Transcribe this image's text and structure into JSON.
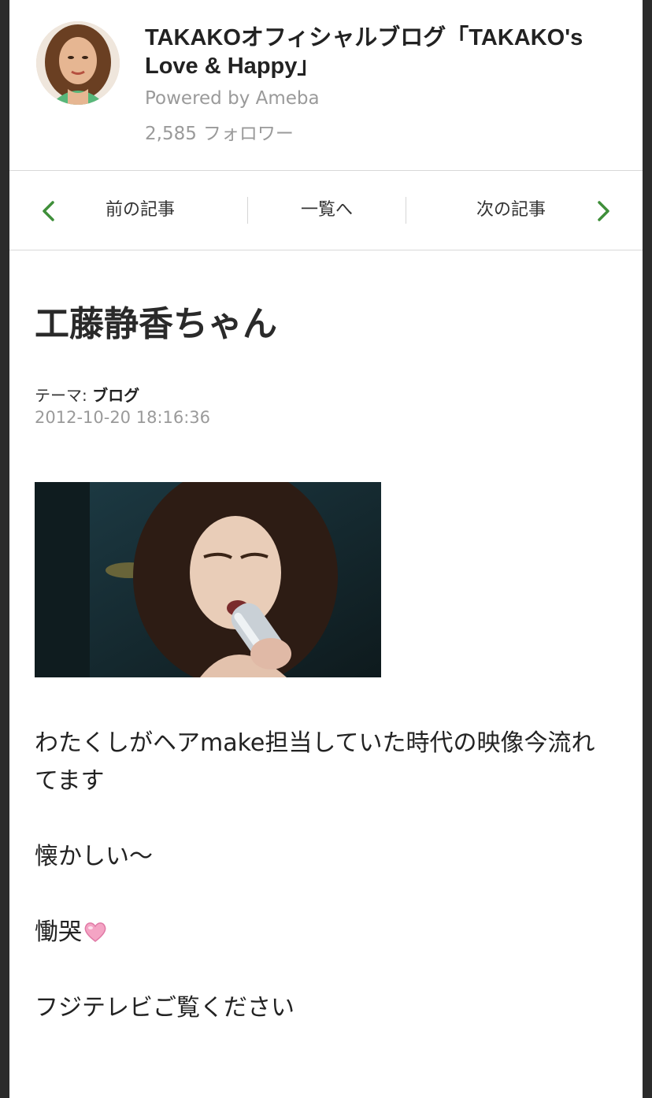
{
  "blog": {
    "title": "TAKAKOオフィシャルブログ「TAKAKO's Love & Happy」",
    "powered_by": "Powered by Ameba",
    "follower_count": "2,585",
    "follower_label": "フォロワー"
  },
  "nav": {
    "prev_label": "前の記事",
    "list_label": "一覧へ",
    "next_label": "次の記事",
    "accent_color": "#3f8f3a"
  },
  "post": {
    "title": "工藤静香ちゃん",
    "theme_label": "テーマ:",
    "theme_value": "ブログ",
    "date": "2012-10-20 18:16:36",
    "paragraphs": [
      "わたくしがヘアmake担当していた時代の映像今流れてます",
      "懐かしい〜",
      "慟哭",
      "フジテレビご覧ください"
    ],
    "emoji_icon": "pink-heart-icon"
  }
}
